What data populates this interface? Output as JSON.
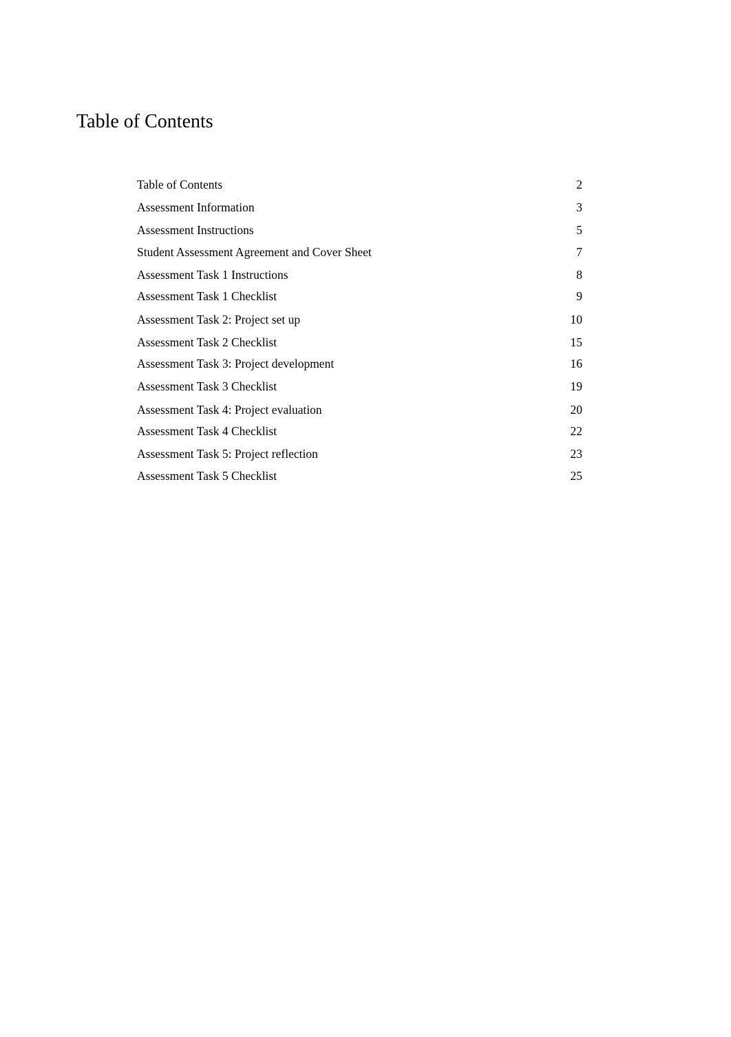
{
  "document": {
    "title": "Table of Contents",
    "toc": [
      {
        "label": "Table of Contents",
        "page": "2"
      },
      {
        "label": "Assessment Information",
        "page": "3"
      },
      {
        "label": "Assessment Instructions",
        "page": "5"
      },
      {
        "label": "Student Assessment Agreement and Cover Sheet",
        "page": "7"
      },
      {
        "label": "Assessment Task 1 Instructions",
        "page": "8"
      },
      {
        "label": "Assessment Task 1 Checklist",
        "page": "9"
      },
      {
        "label": "Assessment Task 2: Project set up",
        "page": "10"
      },
      {
        "label": "Assessment Task 2 Checklist",
        "page": "15"
      },
      {
        "label": "Assessment Task 3: Project development",
        "page": "16"
      },
      {
        "label": "Assessment Task 3 Checklist",
        "page": "19"
      },
      {
        "label": "Assessment Task 4: Project evaluation",
        "page": "20"
      },
      {
        "label": "Assessment Task 4 Checklist",
        "page": "22"
      },
      {
        "label": "Assessment Task 5: Project reflection",
        "page": "23"
      },
      {
        "label": "Assessment Task 5 Checklist",
        "page": "25"
      }
    ]
  }
}
